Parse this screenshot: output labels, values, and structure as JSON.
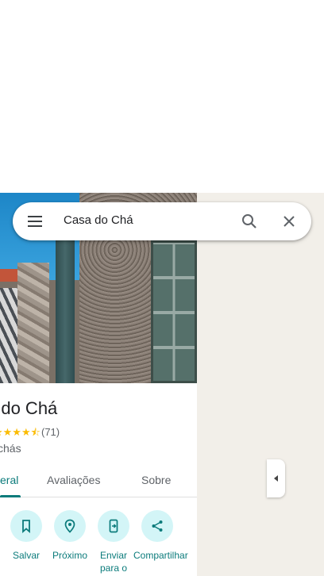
{
  "search": {
    "query": "Casa do Chá"
  },
  "place": {
    "title_fragment": "a do Chá",
    "stars": "★★★★⯪",
    "rating_count": "(71)",
    "category_fragment": "chás"
  },
  "tabs": [
    {
      "label": "eral",
      "active": true
    },
    {
      "label": "Avaliações",
      "active": false
    },
    {
      "label": "Sobre",
      "active": false
    }
  ],
  "actions": [
    {
      "label": "Salvar",
      "icon": "bookmark-icon"
    },
    {
      "label": "Próximo",
      "icon": "nearby-pin-icon"
    },
    {
      "label": "Enviar para o",
      "icon": "send-to-phone-icon"
    },
    {
      "label": "Compartilhar",
      "icon": "share-icon"
    }
  ],
  "colors": {
    "accent": "#0b7b7b",
    "action_bg": "#d3f5f7",
    "star": "#fbbc04",
    "map": "#f2efe9"
  }
}
